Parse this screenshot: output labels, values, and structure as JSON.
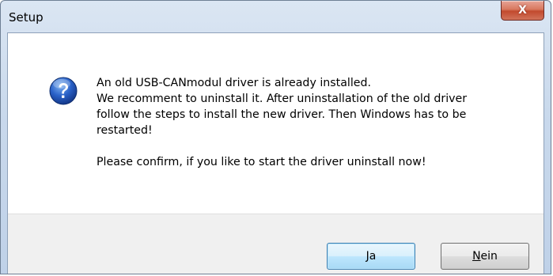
{
  "window": {
    "title": "Setup",
    "close_glyph": "X"
  },
  "dialog": {
    "icon": "question-icon",
    "message_lines": [
      "An old USB-CANmodul driver is already installed.",
      "We recomment to uninstall it. After uninstallation of the old driver",
      "follow the steps to install the new driver. Then Windows has to be",
      "restarted!"
    ],
    "confirm_text": "Please confirm, if you like to start the driver uninstall now!"
  },
  "buttons": {
    "yes_label": "Ja",
    "no_label_mnemonic": "N",
    "no_label_rest": "ein"
  },
  "colors": {
    "accent": "#3c7fb1",
    "close_button": "#c24a2e",
    "frame": "#bfd1e8",
    "footer": "#f0f0f0"
  }
}
